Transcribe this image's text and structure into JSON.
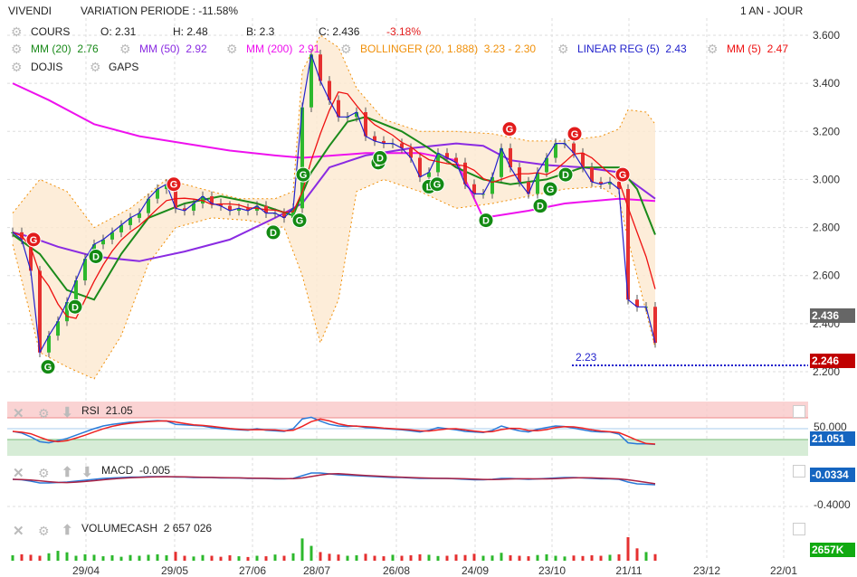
{
  "header": {
    "title": "VIVENDI",
    "variation": "VARIATION PERIODE : -11.58%",
    "period": "1 AN - JOUR"
  },
  "legend": {
    "cours": {
      "label": "COURS",
      "open": "O: 2.31",
      "high": "H: 2.48",
      "low": "B: 2.3",
      "close": "C: 2.436",
      "change": "-3.18%"
    },
    "mm20": {
      "label": "MM (20)",
      "value": "2.76",
      "color": "#1a8a1a"
    },
    "mm50": {
      "label": "MM (50)",
      "value": "2.92",
      "color": "#8a2be2"
    },
    "mm200": {
      "label": "MM (200)",
      "value": "2.91",
      "color": "#ee11ee"
    },
    "bollinger": {
      "label": "BOLLINGER (20, 1.888)",
      "value": "3.23 - 2.30",
      "color": "#f0900a"
    },
    "linreg": {
      "label": "LINEAR REG (5)",
      "value": "2.43",
      "color": "#2222cc"
    },
    "mm5": {
      "label": "MM (5)",
      "value": "2.47",
      "color": "#ee1111"
    },
    "dojis": "DOJIS",
    "gaps": "GAPS"
  },
  "price_badges": {
    "last": "2.436",
    "support": "2.246",
    "support_label": "2.23"
  },
  "rsi": {
    "label": "RSI",
    "value": "21.05",
    "level_label": "50.000",
    "badge": "21.051"
  },
  "macd": {
    "label": "MACD",
    "value": "-0.005",
    "badge": "-0.0334",
    "axis_label": "-0.4000"
  },
  "volume": {
    "label": "VOLUMECASH",
    "value": "2 657 026",
    "badge": "2657K"
  },
  "chart_data": {
    "type": "candlestick",
    "title": "VIVENDI",
    "y_ticks": [
      "3.600",
      "3.400",
      "3.200",
      "3.000",
      "2.800",
      "2.600",
      "2.400",
      "2.200"
    ],
    "ylim": [
      2.2,
      3.6
    ],
    "x_ticks": [
      {
        "label": "29/04",
        "idx": 8.1
      },
      {
        "label": "29/05",
        "idx": 17.9
      },
      {
        "label": "27/06",
        "idx": 26.5
      },
      {
        "label": "28/07",
        "idx": 33.6
      },
      {
        "label": "26/08",
        "idx": 42.4
      },
      {
        "label": "24/09",
        "idx": 51.1
      },
      {
        "label": "23/10",
        "idx": 59.6
      },
      {
        "label": "21/11",
        "idx": 68.1
      },
      {
        "label": "23/12",
        "idx": 76.7
      },
      {
        "label": "22/01",
        "idx": 85.2
      }
    ],
    "close": [
      2.78,
      2.75,
      2.62,
      2.28,
      2.35,
      2.41,
      2.49,
      2.58,
      2.67,
      2.73,
      2.75,
      2.78,
      2.81,
      2.84,
      2.86,
      2.92,
      2.96,
      2.98,
      2.88,
      2.87,
      2.9,
      2.93,
      2.9,
      2.89,
      2.87,
      2.88,
      2.87,
      2.89,
      2.86,
      2.86,
      2.84,
      2.88,
      3.3,
      3.52,
      3.41,
      3.33,
      3.26,
      3.26,
      3.28,
      3.18,
      3.16,
      3.15,
      3.15,
      3.13,
      3.09,
      3.01,
      3.03,
      3.11,
      3.09,
      3.07,
      2.98,
      2.94,
      2.94,
      3.01,
      3.13,
      3.05,
      2.99,
      2.94,
      3.03,
      3.09,
      3.15,
      3.15,
      3.11,
      3.05,
      2.99,
      2.98,
      2.99,
      2.96,
      2.5,
      2.47,
      2.47,
      2.32
    ],
    "mm20": [
      [
        0,
        2.77
      ],
      [
        3,
        2.69
      ],
      [
        6,
        2.54
      ],
      [
        9,
        2.5
      ],
      [
        12,
        2.69
      ],
      [
        15,
        2.84
      ],
      [
        19,
        2.9
      ],
      [
        23,
        2.93
      ],
      [
        27,
        2.9
      ],
      [
        31,
        2.85
      ],
      [
        33,
        3.03
      ],
      [
        35,
        3.14
      ],
      [
        37,
        3.24
      ],
      [
        39,
        3.26
      ],
      [
        43,
        3.2
      ],
      [
        46,
        3.13
      ],
      [
        49,
        3.05
      ],
      [
        52,
        3.0
      ],
      [
        55,
        2.98
      ],
      [
        59,
        3.0
      ],
      [
        63,
        3.05
      ],
      [
        67,
        3.05
      ],
      [
        69,
        2.96
      ],
      [
        71,
        2.77
      ]
    ],
    "mm50": [
      [
        0,
        2.78
      ],
      [
        2,
        2.76
      ],
      [
        5,
        2.72
      ],
      [
        9,
        2.68
      ],
      [
        14,
        2.66
      ],
      [
        19,
        2.7
      ],
      [
        24,
        2.75
      ],
      [
        29,
        2.84
      ],
      [
        32,
        2.9
      ],
      [
        35,
        3.05
      ],
      [
        39,
        3.1
      ],
      [
        44,
        3.13
      ],
      [
        49,
        3.15
      ],
      [
        52,
        3.14
      ],
      [
        55,
        3.08
      ],
      [
        59,
        3.06
      ],
      [
        63,
        3.05
      ],
      [
        67,
        3.03
      ],
      [
        71,
        2.92
      ]
    ],
    "mm200": [
      [
        0,
        3.4
      ],
      [
        4,
        3.33
      ],
      [
        9,
        3.23
      ],
      [
        14,
        3.18
      ],
      [
        19,
        3.15
      ],
      [
        24,
        3.12
      ],
      [
        29,
        3.1
      ],
      [
        32,
        3.09
      ],
      [
        39,
        3.11
      ],
      [
        45,
        3.11
      ],
      [
        49,
        3.08
      ],
      [
        52,
        2.84
      ],
      [
        57,
        2.87
      ],
      [
        61,
        2.9
      ],
      [
        67,
        2.92
      ],
      [
        71,
        2.91
      ]
    ],
    "bollinger_upper": [
      [
        0,
        2.86
      ],
      [
        3,
        3.0
      ],
      [
        6,
        2.95
      ],
      [
        9,
        2.8
      ],
      [
        13,
        2.88
      ],
      [
        17,
        3.0
      ],
      [
        21,
        2.96
      ],
      [
        25,
        2.92
      ],
      [
        29,
        2.92
      ],
      [
        31,
        2.95
      ],
      [
        32,
        3.45
      ],
      [
        34,
        3.6
      ],
      [
        36,
        3.55
      ],
      [
        38,
        3.38
      ],
      [
        41,
        3.25
      ],
      [
        45,
        3.2
      ],
      [
        49,
        3.2
      ],
      [
        53,
        3.19
      ],
      [
        57,
        3.16
      ],
      [
        61,
        3.16
      ],
      [
        65,
        3.18
      ],
      [
        67,
        3.21
      ],
      [
        68,
        3.29
      ],
      [
        70,
        3.28
      ],
      [
        71,
        3.23
      ]
    ],
    "bollinger_lower": [
      [
        0,
        2.73
      ],
      [
        3,
        2.28
      ],
      [
        6,
        2.22
      ],
      [
        9,
        2.17
      ],
      [
        12,
        2.35
      ],
      [
        15,
        2.65
      ],
      [
        18,
        2.8
      ],
      [
        22,
        2.84
      ],
      [
        26,
        2.83
      ],
      [
        30,
        2.8
      ],
      [
        32,
        2.6
      ],
      [
        34,
        2.32
      ],
      [
        36,
        2.5
      ],
      [
        38,
        2.95
      ],
      [
        41,
        3.0
      ],
      [
        45,
        2.95
      ],
      [
        49,
        2.88
      ],
      [
        53,
        2.9
      ],
      [
        57,
        2.93
      ],
      [
        61,
        2.96
      ],
      [
        65,
        2.97
      ],
      [
        67,
        2.92
      ],
      [
        68,
        2.75
      ],
      [
        70,
        2.45
      ],
      [
        71,
        2.3
      ]
    ],
    "signals": [
      {
        "idx": 2.3,
        "price": 2.75,
        "letter": "G",
        "color": "#e21b1b"
      },
      {
        "idx": 3.9,
        "price": 2.22,
        "letter": "G",
        "color": "#138a13"
      },
      {
        "idx": 6.9,
        "price": 2.47,
        "letter": "D",
        "color": "#138a13"
      },
      {
        "idx": 9.2,
        "price": 2.68,
        "letter": "D",
        "color": "#138a13"
      },
      {
        "idx": 17.8,
        "price": 2.98,
        "letter": "G",
        "color": "#e21b1b"
      },
      {
        "idx": 28.8,
        "price": 2.78,
        "letter": "D",
        "color": "#138a13"
      },
      {
        "idx": 31.7,
        "price": 2.83,
        "letter": "G",
        "color": "#138a13"
      },
      {
        "idx": 32.1,
        "price": 3.02,
        "letter": "G",
        "color": "#138a13"
      },
      {
        "idx": 40.4,
        "price": 3.07,
        "letter": "D",
        "color": "#138a13"
      },
      {
        "idx": 40.6,
        "price": 3.09,
        "letter": "D",
        "color": "#138a13"
      },
      {
        "idx": 46.0,
        "price": 2.97,
        "letter": "L",
        "color": "#138a13"
      },
      {
        "idx": 46.9,
        "price": 2.98,
        "letter": "G",
        "color": "#138a13"
      },
      {
        "idx": 52.3,
        "price": 2.83,
        "letter": "D",
        "color": "#138a13"
      },
      {
        "idx": 54.9,
        "price": 3.21,
        "letter": "G",
        "color": "#e21b1b"
      },
      {
        "idx": 58.3,
        "price": 2.89,
        "letter": "D",
        "color": "#138a13"
      },
      {
        "idx": 59.4,
        "price": 2.96,
        "letter": "G",
        "color": "#138a13"
      },
      {
        "idx": 61.1,
        "price": 3.02,
        "letter": "D",
        "color": "#138a13"
      },
      {
        "idx": 62.1,
        "price": 3.19,
        "letter": "G",
        "color": "#e21b1b"
      },
      {
        "idx": 67.4,
        "price": 3.02,
        "letter": "G",
        "color": "#e21b1b"
      }
    ],
    "rsi": [
      45,
      42,
      35,
      26,
      24,
      28,
      32,
      38,
      44,
      50,
      55,
      58,
      60,
      62,
      63,
      64,
      65,
      64,
      58,
      57,
      56,
      55,
      52,
      50,
      49,
      48,
      47,
      50,
      47,
      46,
      45,
      50,
      68,
      71,
      64,
      58,
      55,
      54,
      55,
      52,
      51,
      50,
      49,
      48,
      46,
      44,
      47,
      52,
      50,
      48,
      45,
      44,
      43,
      47,
      55,
      50,
      46,
      44,
      49,
      52,
      55,
      54,
      51,
      48,
      45,
      44,
      44,
      40,
      24,
      22,
      22,
      21
    ],
    "macd_ylim": [
      -0.4,
      0.1
    ],
    "macd": [
      -0.02,
      -0.03,
      -0.06,
      -0.1,
      -0.1,
      -0.09,
      -0.08,
      -0.06,
      -0.04,
      -0.02,
      0,
      0.01,
      0.02,
      0.03,
      0.03,
      0.04,
      0.04,
      0.04,
      0.03,
      0.03,
      0.02,
      0.02,
      0.02,
      0.01,
      0.01,
      0.01,
      0.0,
      0.0,
      0.0,
      -0.01,
      -0.01,
      0.0,
      0.06,
      0.12,
      0.12,
      0.1,
      0.08,
      0.07,
      0.06,
      0.05,
      0.04,
      0.03,
      0.02,
      0.02,
      0.01,
      0.0,
      0.0,
      0.0,
      0.0,
      -0.01,
      -0.02,
      -0.03,
      -0.03,
      -0.02,
      0.0,
      0.0,
      -0.01,
      -0.02,
      -0.01,
      0.0,
      0.01,
      0.02,
      0.02,
      0.01,
      0.0,
      -0.01,
      -0.01,
      -0.02,
      -0.08,
      -0.12,
      -0.13,
      -0.14
    ],
    "volume": [
      2200,
      2600,
      2400,
      2000,
      3000,
      4000,
      3400,
      2000,
      2600,
      2400,
      1800,
      2200,
      1600,
      2300,
      2000,
      2400,
      2600,
      2200,
      3600,
      2000,
      1700,
      2300,
      2000,
      1600,
      2200,
      1800,
      1500,
      2000,
      1800,
      2500,
      2000,
      3000,
      9000,
      6000,
      3500,
      2800,
      2500,
      2000,
      2200,
      2800,
      2000,
      1800,
      2400,
      2000,
      2200,
      2600,
      2400,
      1900,
      2000,
      2500,
      2300,
      2800,
      2000,
      2100,
      3200,
      2200,
      2000,
      1800,
      2300,
      2600,
      2000,
      1700,
      2100,
      1900,
      2200,
      2000,
      2400,
      2600,
      9500,
      5000,
      3500,
      2657
    ]
  }
}
